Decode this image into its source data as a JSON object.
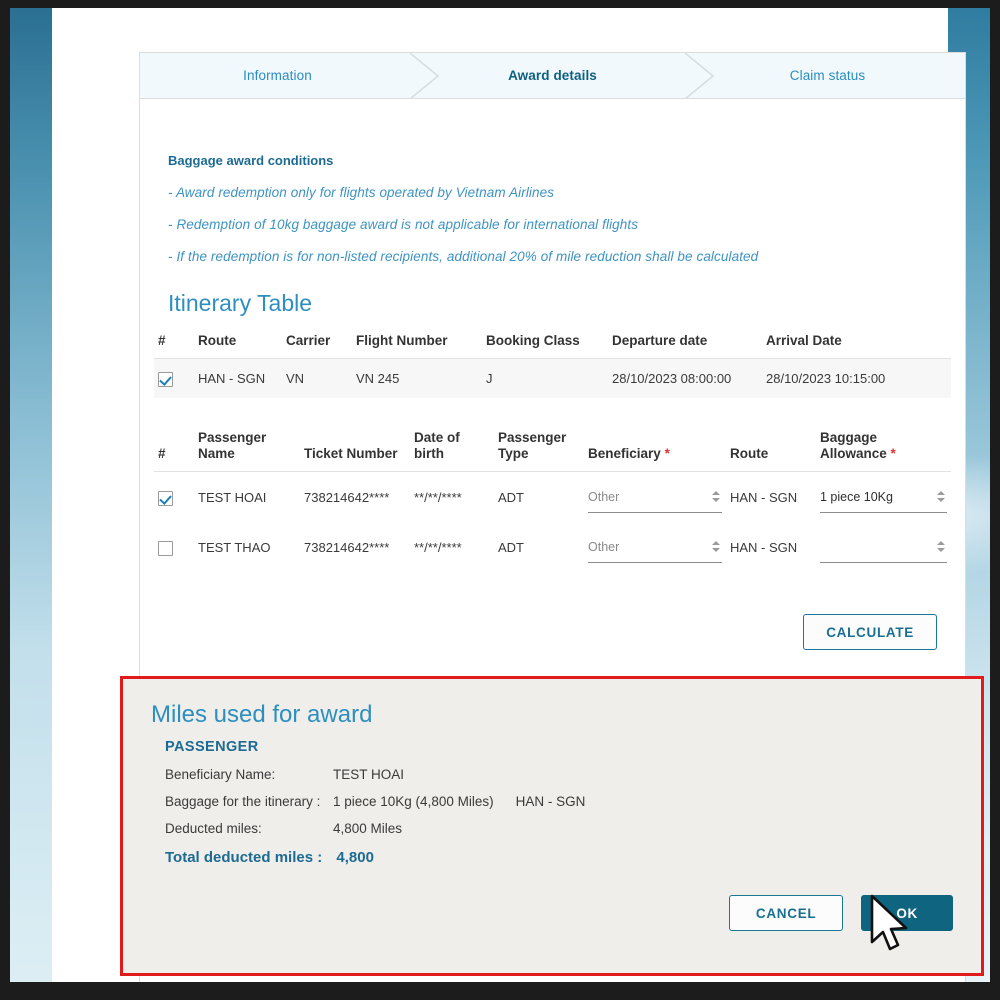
{
  "stepper": {
    "steps": [
      {
        "label": "Information",
        "active": false
      },
      {
        "label": "Award details",
        "active": true
      },
      {
        "label": "Claim status",
        "active": false
      }
    ]
  },
  "conditions": {
    "title": "Baggage award conditions",
    "lines": [
      "- Award redemption only for flights operated by Vietnam Airlines",
      "- Redemption of 10kg baggage award is not applicable for international flights",
      "- If the redemption is for non-listed recipients, additional 20% of mile reduction shall be calculated"
    ]
  },
  "itinerary": {
    "title": "Itinerary Table",
    "headers": [
      "#",
      "Route",
      "Carrier",
      "Flight Number",
      "Booking Class",
      "Departure date",
      "Arrival Date"
    ],
    "rows": [
      {
        "selected": true,
        "route": "HAN - SGN",
        "carrier": "VN",
        "flight_number": "VN 245",
        "booking_class": "J",
        "departure_date": "28/10/2023 08:00:00",
        "arrival_date": "28/10/2023 10:15:00"
      }
    ]
  },
  "passengers": {
    "headers": {
      "index": "#",
      "name": "Passenger Name",
      "ticket": "Ticket Number",
      "dob": "Date of birth",
      "type": "Passenger Type",
      "beneficiary": "Beneficiary",
      "route": "Route",
      "baggage": "Baggage Allowance",
      "required_mark": "*"
    },
    "rows": [
      {
        "selected": true,
        "name": "TEST HOAI",
        "ticket": "738214642****",
        "dob": "**/**/****",
        "type": "ADT",
        "beneficiary_value": "Other",
        "route": "HAN - SGN",
        "baggage_value": "1 piece 10Kg",
        "baggage_filled": true
      },
      {
        "selected": false,
        "name": "TEST THAO",
        "ticket": "738214642****",
        "dob": "**/**/****",
        "type": "ADT",
        "beneficiary_value": "Other",
        "route": "HAN - SGN",
        "baggage_value": "",
        "baggage_filled": false
      }
    ]
  },
  "actions": {
    "calculate": "CALCULATE",
    "cancel": "CANCEL",
    "ok": "OK"
  },
  "miles_panel": {
    "title": "Miles used for award",
    "passenger_label": "PASSENGER",
    "beneficiary_name_label": "Beneficiary Name:",
    "beneficiary_name_value": "TEST HOAI",
    "baggage_label": "Baggage for the itinerary :",
    "baggage_value": "1 piece 10Kg (4,800 Miles)",
    "baggage_route": "HAN - SGN",
    "deducted_label": "Deducted miles:",
    "deducted_value": "4,800 Miles",
    "total_label": "Total deducted miles :",
    "total_value": "4,800"
  },
  "colors": {
    "accent_blue": "#2e8fbf",
    "dark_blue": "#1d6b92",
    "button_solid": "#0f6480",
    "required_red": "#e03131",
    "highlight_red": "#e01b1b",
    "panel_bg": "#efeeea",
    "stepper_bg": "#f2f9fc"
  }
}
